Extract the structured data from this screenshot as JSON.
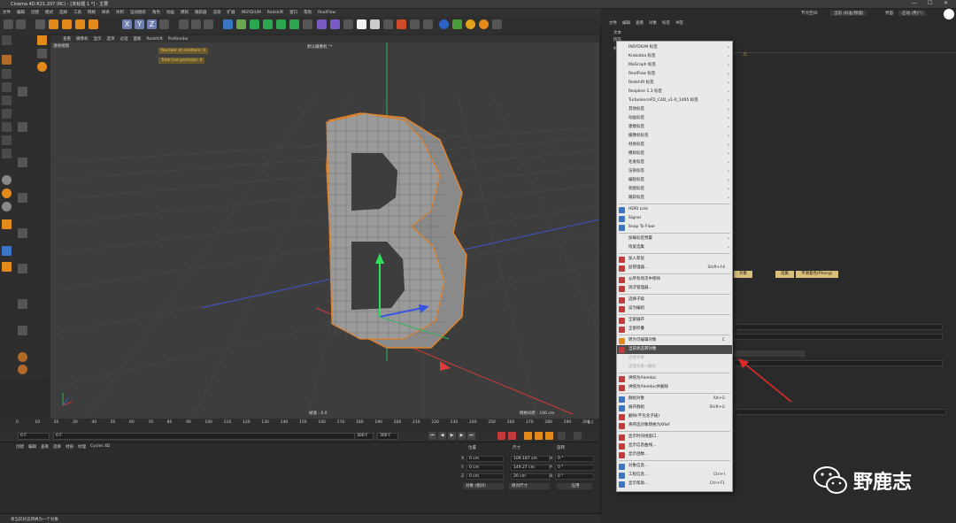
{
  "window": {
    "title": "Cinema 4D R21.207 (RC) - [未标题 1 *] - 主要"
  },
  "menubar": [
    "文件",
    "编辑",
    "创建",
    "模式",
    "选择",
    "工具",
    "网格",
    "样条",
    "体积",
    "运动图形",
    "角色",
    "动画",
    "模拟",
    "跟踪器",
    "渲染",
    "扩展",
    "INSYDIUM",
    "Redshift",
    "窗口",
    "帮助",
    "RealFlow"
  ],
  "right_menubar": {
    "items": [
      "文件",
      "编辑",
      "查看",
      "对象",
      "标签",
      "书签"
    ],
    "layout_label": "节点空间:",
    "layout_value": "当前 (标准/物理)",
    "interface_label": "界面:",
    "interface_value": "启动 (用户)"
  },
  "viewport": {
    "menu": [
      "查看",
      "摄像机",
      "显示",
      "选项",
      "过滤",
      "面板",
      "Redshift",
      "ProRender"
    ],
    "view_name": "透视视图",
    "camera_name": "默认摄像机 °*",
    "hud": [
      "Number of emitters: 0",
      "Total live particles: 0"
    ],
    "fps": "帧速 : 0.0",
    "grid": "网格间距 : 100 cm"
  },
  "timeline": {
    "ticks": [
      "0",
      "5",
      "10",
      "15",
      "20",
      "25",
      "30",
      "35",
      "40",
      "45",
      "50",
      "55",
      "60",
      "65",
      "70",
      "75",
      "80",
      "85",
      "90",
      "95",
      "100",
      "105",
      "110",
      "115",
      "120",
      "125",
      "130",
      "135",
      "140",
      "145",
      "150",
      "155",
      "160",
      "165",
      "170",
      "175",
      "180",
      "185",
      "190",
      "195",
      "200",
      "205",
      "210",
      "215",
      "220",
      "225",
      "230",
      "235",
      "240",
      "245",
      "250",
      "255",
      "260",
      "265",
      "270",
      "275",
      "280",
      "285",
      "290",
      "295",
      "300"
    ],
    "end_label": "0 F"
  },
  "transport": {
    "start": "0 F",
    "current": "0 F",
    "end1": "300 F",
    "end2": "300 F"
  },
  "material_menu": [
    "创建",
    "编辑",
    "查看",
    "选择",
    "材质",
    "纹理",
    "Cycles 4D"
  ],
  "coords": {
    "headers": [
      "位置",
      "尺寸",
      "旋转"
    ],
    "rows": [
      {
        "axis": "X",
        "pos": "0 cm",
        "size": "109.187 cm",
        "rot_axis": "H",
        "rot": "0 °"
      },
      {
        "axis": "Y",
        "pos": "0 cm",
        "size": "149.27 cm",
        "rot_axis": "P",
        "rot": "0 °"
      },
      {
        "axis": "Z",
        "pos": "0 cm",
        "size": "20 cm",
        "rot_axis": "B",
        "rot": "0 °"
      }
    ],
    "mode": "对象 (相对)",
    "size_mode": "绝对尺寸",
    "apply": "应用"
  },
  "status": "将当前状态转换为一个对象",
  "object_panel": {
    "items": [
      "文本",
      "挤压",
      "材"
    ]
  },
  "attr_panel": {
    "tabs": [
      "基本",
      "坐标",
      "对象",
      "封顶",
      "选集",
      "平滑着色(Phong)"
    ],
    "rows": [
      "数",
      "模",
      "基",
      "使",
      "可",
      "优"
    ]
  },
  "context_menu": {
    "items": [
      {
        "label": "INSYDIUM 标签",
        "arrow": true
      },
      {
        "label": "Krakatoa 标签",
        "arrow": true
      },
      {
        "label": "MoGraph 标签",
        "arrow": true
      },
      {
        "label": "RealFlow 标签",
        "arrow": true
      },
      {
        "label": "Redshift 标签",
        "arrow": true
      },
      {
        "label": "Respline 1.3 标签",
        "arrow": true
      },
      {
        "label": "TurbulenceFD_C4D_v1-0_1465 标签",
        "arrow": true
      },
      {
        "label": "其他标签",
        "arrow": true
      },
      {
        "label": "动画标签",
        "arrow": true
      },
      {
        "label": "建模标签",
        "arrow": true
      },
      {
        "label": "摄像机标签",
        "arrow": true
      },
      {
        "label": "材质标签",
        "arrow": true
      },
      {
        "label": "模拟标签",
        "arrow": true
      },
      {
        "label": "毛发标签",
        "arrow": true
      },
      {
        "label": "渲染标签",
        "arrow": true
      },
      {
        "label": "编程标签",
        "arrow": true
      },
      {
        "label": "装配标签",
        "arrow": true
      },
      {
        "label": "跟踪标签",
        "arrow": true
      },
      {
        "label": "HDRI Link",
        "arrow": false
      },
      {
        "label": "Signal",
        "arrow": false
      },
      {
        "label": "Snap To Floor",
        "arrow": false
      },
      {
        "label": "加载标签预置",
        "arrow": true
      },
      {
        "label": "恢复选集",
        "arrow": true
      },
      {
        "label": "加入新层",
        "arrow": false
      },
      {
        "label": "层管理器...",
        "shortcut": "Shift+F4"
      },
      {
        "label": "从所有场次中移除",
        "arrow": false
      },
      {
        "label": "场次管理器...",
        "arrow": false
      },
      {
        "label": "选择子级",
        "arrow": false
      },
      {
        "label": "设为编组",
        "arrow": false
      },
      {
        "label": "全部展开",
        "arrow": false
      },
      {
        "label": "全部折叠",
        "arrow": false
      },
      {
        "label": "转为可编辑对象",
        "shortcut": "C"
      },
      {
        "label": "当前状态转对象",
        "arrow": false
      },
      {
        "label": "连接对象",
        "arrow": false
      },
      {
        "label": "连接对象+删除",
        "arrow": false
      },
      {
        "label": "烘焙为Alembic",
        "arrow": false
      },
      {
        "label": "烘焙为Alembic并删除",
        "arrow": false
      },
      {
        "label": "群组对象",
        "shortcut": "Alt+G"
      },
      {
        "label": "展开群组",
        "shortcut": "Shift+G"
      },
      {
        "label": "删除(不包含子级)",
        "arrow": false
      },
      {
        "label": "将所选对象转换为XRef",
        "arrow": false
      },
      {
        "label": "显示时间线窗口...",
        "arrow": false
      },
      {
        "label": "显示信息曲线...",
        "arrow": false
      },
      {
        "label": "显示函数...",
        "arrow": false
      },
      {
        "label": "对象信息...",
        "arrow": false
      },
      {
        "label": "工程信息...",
        "shortcut": "Ctrl+I"
      },
      {
        "label": "显示帮助...",
        "shortcut": "Ctrl+F1"
      }
    ]
  },
  "watermark": {
    "text": "野鹿志"
  }
}
